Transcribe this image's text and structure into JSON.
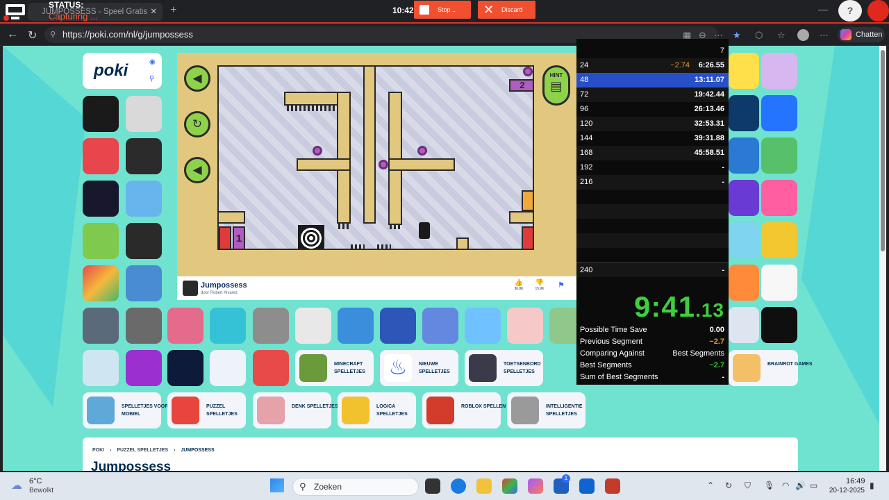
{
  "recorder": {
    "status_title": "STATUS:",
    "status_sub": "Capturing ...",
    "clock": "10:42",
    "stop_label": "Stop ..",
    "discard_label": "Discard",
    "help": "?"
  },
  "browser": {
    "tab_title": "JUMPOSSESS - Speel Gratis Online",
    "url": "https://poki.com/nl/g/jumpossess",
    "chat_label": "Chatten"
  },
  "poki": {
    "logo": "poki"
  },
  "game": {
    "title": "Jumpossess",
    "author": "door Robert Alvarez",
    "hint": "HINT",
    "door_left": "1",
    "door_right": "2",
    "likes": "36.8K",
    "dislikes": "15.9K",
    "icons": {
      "back": "play-back-icon",
      "restart": "restart-icon",
      "sound": "speaker-icon",
      "like": "thumbs-up-icon",
      "dislike": "thumbs-down-icon",
      "report": "flag-icon",
      "hint": "film-icon"
    }
  },
  "categories": [
    {
      "label": "MINECRAFT SPELLETJES",
      "color": "#6a9a3a"
    },
    {
      "label": "NIEUWE SPELLETJES",
      "color": "#2f6cff"
    },
    {
      "label": "TOETSENBORD SPELLETJES",
      "color": "#3a3a4a"
    },
    {
      "label": "BRAINROT GAMES",
      "color": "#f3c068"
    },
    {
      "label": "SPELLETJES VOOR MOBIEL",
      "color": "#5ea9d8"
    },
    {
      "label": "PUZZEL SPELLETJES",
      "color": "#e8453c"
    },
    {
      "label": "DENK SPELLETJES",
      "color": "#e5a2a8"
    },
    {
      "label": "LOGICA SPELLETJES",
      "color": "#f2c22e"
    },
    {
      "label": "ROBLOX SPELLEN",
      "color": "#d33b2b"
    },
    {
      "label": "INTELLIGENTIE SPELLETJES",
      "color": "#9a9a9a"
    }
  ],
  "breadcrumb": [
    "POKI",
    "PUZZEL SPELLETJES",
    "JUMPOSSESS"
  ],
  "page_heading": "Jumpossess",
  "splits": {
    "header_count": "7",
    "rows": [
      {
        "name": "24",
        "delta": "−2.74",
        "time": "6:26.55"
      },
      {
        "name": "48",
        "delta": "",
        "time": "13:11.07"
      },
      {
        "name": "72",
        "delta": "",
        "time": "19:42.44"
      },
      {
        "name": "96",
        "delta": "",
        "time": "26:13.46"
      },
      {
        "name": "120",
        "delta": "",
        "time": "32:53.31"
      },
      {
        "name": "144",
        "delta": "",
        "time": "39:31.88"
      },
      {
        "name": "168",
        "delta": "",
        "time": "45:58.51"
      },
      {
        "name": "192",
        "delta": "",
        "time": "-"
      },
      {
        "name": "216",
        "delta": "",
        "time": "-"
      }
    ],
    "last_row": {
      "name": "240",
      "time": "-"
    },
    "timer_main": "9:41",
    "timer_frac": ".13",
    "stats": [
      {
        "label": "Possible Time Save",
        "value": "0.00"
      },
      {
        "label": "Previous Segment",
        "value": "−2.7"
      },
      {
        "label": "Comparing Against",
        "value": "Best Segments"
      },
      {
        "label": "Best Segments",
        "value": "−2.7"
      },
      {
        "label": "Sum of Best Segments",
        "value": "-"
      }
    ]
  },
  "taskbar": {
    "temp": "6°C",
    "weather": "Bewolkt",
    "search": "Zoeken",
    "time": "16:49",
    "date": "20-12-2025",
    "badge": "1"
  },
  "colors": {
    "accent_green": "#3ecf3e",
    "gold": "#e8a020",
    "split_highlight": "#2750c8",
    "poki_blue": "#002b50",
    "rec_red": "#f05030"
  }
}
